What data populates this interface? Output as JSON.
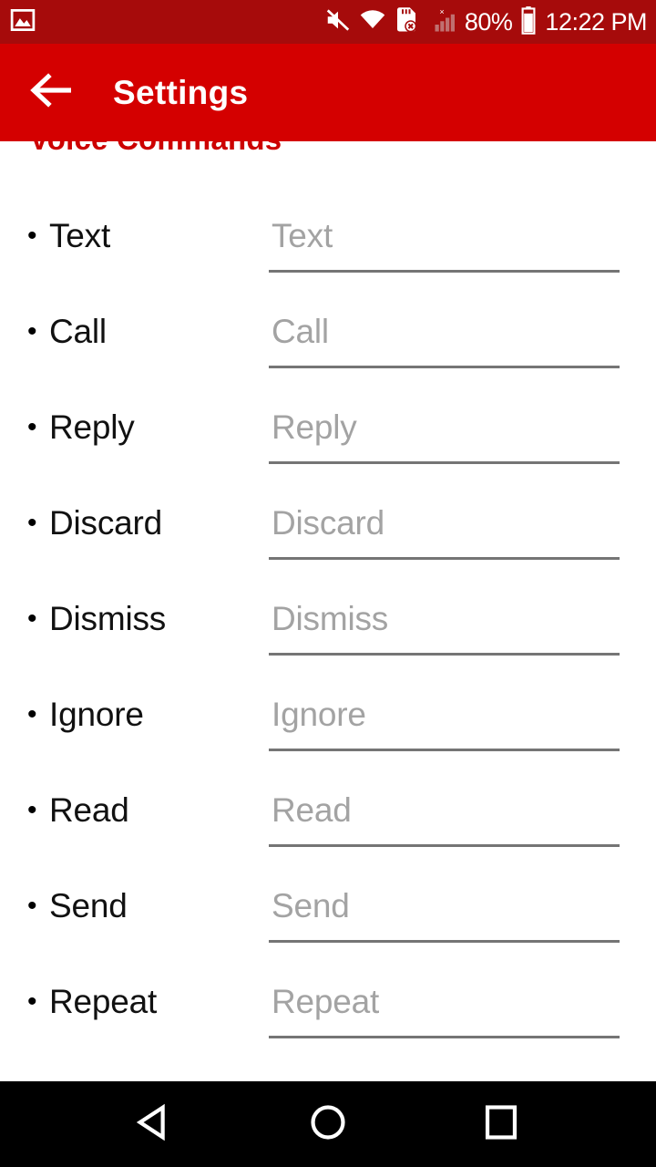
{
  "status_bar": {
    "background_color": "#a60b0b",
    "notification_icon": "image-notification-icon",
    "icons": [
      "volume-muted-icon",
      "wifi-icon",
      "sd-card-error-icon",
      "signal-bars-no-service-icon"
    ],
    "battery_percent": "80%",
    "battery_icon": "battery-icon",
    "clock": "12:22 PM"
  },
  "app_bar": {
    "background_color": "#d40000",
    "back_icon": "arrow-left-icon",
    "title": "Settings"
  },
  "content": {
    "section_title": "Voice Commands",
    "section_title_color": "#cc0000",
    "rows": [
      {
        "label": "Text",
        "value": "",
        "placeholder": "Text"
      },
      {
        "label": "Call",
        "value": "",
        "placeholder": "Call"
      },
      {
        "label": "Reply",
        "value": "",
        "placeholder": "Reply"
      },
      {
        "label": "Discard",
        "value": "",
        "placeholder": "Discard"
      },
      {
        "label": "Dismiss",
        "value": "",
        "placeholder": "Dismiss"
      },
      {
        "label": "Ignore",
        "value": "",
        "placeholder": "Ignore"
      },
      {
        "label": "Read",
        "value": "",
        "placeholder": "Read"
      },
      {
        "label": "Send",
        "value": "",
        "placeholder": "Send"
      },
      {
        "label": "Repeat",
        "value": "",
        "placeholder": "Repeat"
      }
    ],
    "bullet": "•"
  },
  "nav_bar": {
    "background_color": "#000000",
    "buttons": [
      {
        "name": "back",
        "icon": "triangle-left-icon"
      },
      {
        "name": "home",
        "icon": "circle-icon"
      },
      {
        "name": "recents",
        "icon": "square-icon"
      }
    ]
  }
}
